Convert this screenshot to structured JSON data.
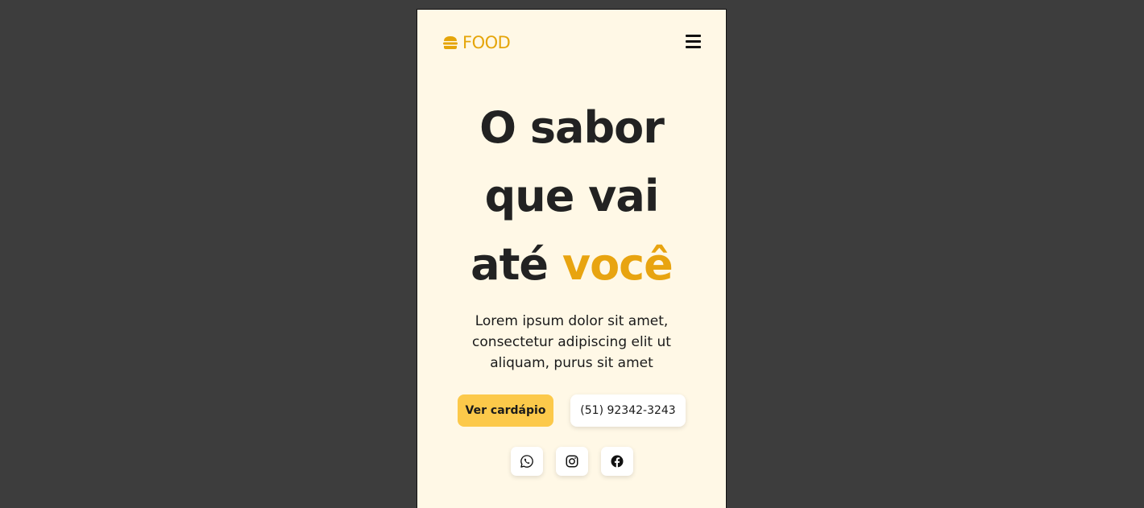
{
  "header": {
    "logo_text": "FOOD",
    "logo_icon": "burger-icon",
    "menu_icon": "hamburger-menu-icon"
  },
  "hero": {
    "title_line1": "O sabor",
    "title_line2": "que vai",
    "title_line3_start": "até",
    "title_line3_accent": "você",
    "description": "Lorem ipsum dolor sit amet, consectetur adipiscing elit ut aliquam, purus sit amet"
  },
  "actions": {
    "menu_button_label": "Ver cardápio",
    "phone_button_label": "(51) 92342-3243"
  },
  "social": [
    {
      "icon": "whatsapp-icon"
    },
    {
      "icon": "instagram-icon"
    },
    {
      "icon": "facebook-icon"
    }
  ],
  "colors": {
    "page_background": "#3d3d3d",
    "surface": "#fff8e6",
    "accent": "#e8a410",
    "primary_button": "#fcc94a",
    "text": "#222222"
  }
}
